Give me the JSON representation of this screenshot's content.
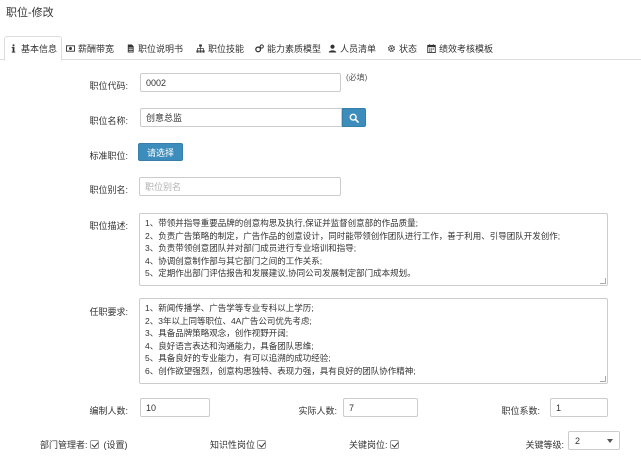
{
  "page": {
    "title": "职位-修改"
  },
  "tabs": [
    {
      "label": "基本信息",
      "icon": "info-icon",
      "active": true
    },
    {
      "label": "薪酬带宽",
      "icon": "money-icon"
    },
    {
      "label": "职位说明书",
      "icon": "file-icon"
    },
    {
      "label": "职位技能",
      "icon": "sitemap-icon"
    },
    {
      "label": "能力素质模型",
      "icon": "gears-icon"
    },
    {
      "label": "人员清单",
      "icon": "user-icon"
    },
    {
      "label": "状态",
      "icon": "gear-icon"
    },
    {
      "label": "绩效考核模板",
      "icon": "calendar-icon"
    }
  ],
  "form": {
    "code": {
      "label": "职位代码:",
      "value": "0002",
      "hint": "(必填)"
    },
    "name": {
      "label": "职位名称:",
      "value": "创意总监"
    },
    "standard": {
      "label": "标准职位:",
      "button": "请选择"
    },
    "alias": {
      "label": "职位别名:",
      "placeholder": "职位别名",
      "value": ""
    },
    "description": {
      "label": "职位描述:",
      "lines": [
        "1、带领并指导重要品牌的创意构思及执行,保证并监督创意部的作品质量;",
        "2、负责广告策略的制定，广告作品的创意设计，同时能带领创作团队进行工作，善于利用、引导团队开发创作;",
        "3、负责带领创意团队并对部门成员进行专业培训和指导;",
        "4、协调创意制作部与其它部门之间的工作关系;",
        "5、定期作出部门评估报告和发展建议,协同公司发展制定部门成本规划。"
      ]
    },
    "requirements": {
      "label": "任职要求:",
      "lines": [
        "1、新闻传播学、广告学等专业专科以上学历;",
        "2、3年以上同等职位、4A广告公司优先考虑;",
        "3、具备品牌策略观念，创作视野开阔;",
        "4、良好语言表达和沟通能力，具备团队思维;",
        "5、具备良好的专业能力，有可以追溯的成功经验;",
        "6、创作欲望强烈，创意构思独特、表现力强，具有良好的团队协作精神;"
      ]
    },
    "headcount": {
      "label": "编制人数:",
      "value": "10"
    },
    "actual": {
      "label": "实际人数:",
      "value": "7"
    },
    "coefficient": {
      "label": "职位系数:",
      "value": "1"
    },
    "dept_manager": {
      "label": "部门管理者:",
      "link": "(设置)",
      "checked": true
    },
    "knowledge": {
      "label": "知识性岗位",
      "checked": true
    },
    "key_post": {
      "label": "关键岗位:",
      "checked": true
    },
    "key_level": {
      "label": "关键等级:",
      "value": "2"
    }
  },
  "colors": {
    "primary": "#3c8dbc",
    "border": "#cccccc",
    "text": "#333333"
  }
}
